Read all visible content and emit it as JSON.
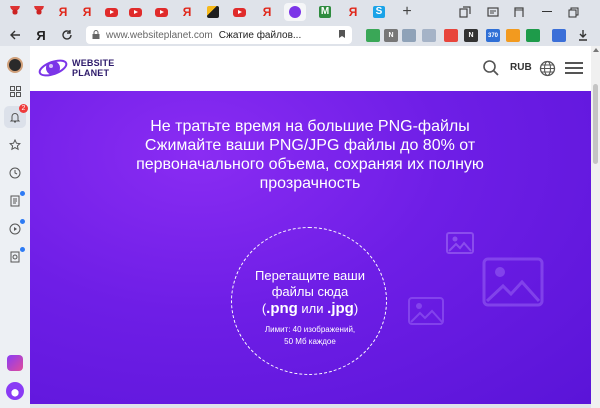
{
  "browser": {
    "tabs": [
      {
        "icon": "flower-favicon-icon",
        "kind": "flower"
      },
      {
        "icon": "flower-favicon-icon",
        "kind": "flower"
      },
      {
        "icon": "yandex-icon",
        "kind": "ya",
        "glyph": "Я"
      },
      {
        "icon": "youtube-icon",
        "kind": "yt"
      },
      {
        "icon": "youtube-icon",
        "kind": "yt"
      },
      {
        "icon": "yandex-icon",
        "kind": "ya",
        "glyph": "Я"
      },
      {
        "icon": "mountain-favicon-icon",
        "kind": "mtn"
      },
      {
        "icon": "youtube-icon",
        "kind": "yt"
      },
      {
        "icon": "yandex-icon",
        "kind": "ya",
        "glyph": "Я"
      },
      {
        "icon": "websiteplanet-favicon-icon",
        "kind": "wp",
        "active": true
      },
      {
        "icon": "m-favicon-icon",
        "kind": "m",
        "glyph": "M"
      },
      {
        "icon": "yandex-icon",
        "kind": "ya",
        "glyph": "Я"
      },
      {
        "icon": "s-favicon-icon",
        "kind": "s",
        "glyph": "S"
      }
    ],
    "new_tab_glyph": "+",
    "url_domain": "www.websiteplanet.com",
    "url_title": "Сжатие файлов...",
    "yandex_glyph": "Я",
    "extensions": [
      {
        "name": "ext-1",
        "color": "#3aa757",
        "text": ""
      },
      {
        "name": "ext-2",
        "color": "#777777",
        "text": "N"
      },
      {
        "name": "ext-3",
        "color": "#e8453c",
        "text": ""
      },
      {
        "name": "ext-4",
        "color": "#333333",
        "text": "N"
      },
      {
        "name": "ext-5",
        "color": "#2f6fd6",
        "text": "370"
      },
      {
        "name": "ext-6",
        "color": "#f29a1f",
        "text": ""
      },
      {
        "name": "ext-7",
        "color": "#1e9b4a",
        "text": ""
      },
      {
        "name": "ext-8",
        "color": "#3b6fd8",
        "text": ""
      }
    ]
  },
  "site": {
    "logo_line1": "WEBSITE",
    "logo_line2": "PLANET",
    "currency": "RUB",
    "hero": {
      "line1": "Не тратьте время на большие PNG-файлы",
      "line2": "Сжимайте ваши PNG/JPG файлы до 80% от",
      "line3": "первоначального объема, сохраняя их полную",
      "line4": "прозрачность"
    },
    "dropzone": {
      "line1": "Перетащите ваши",
      "line2": "файлы сюда",
      "fmt_png": ".png",
      "fmt_or": " или ",
      "fmt_jpg": ".jpg",
      "fmt_open": "(",
      "fmt_close": ")",
      "limit1": "Лимит: 40 изображений,",
      "limit2": "50 Мб каждое"
    }
  },
  "sidebar": {
    "notification_count": "2"
  },
  "colors": {
    "hero_purple": "#6e1ee6",
    "logo_purple": "#7b35e8"
  }
}
